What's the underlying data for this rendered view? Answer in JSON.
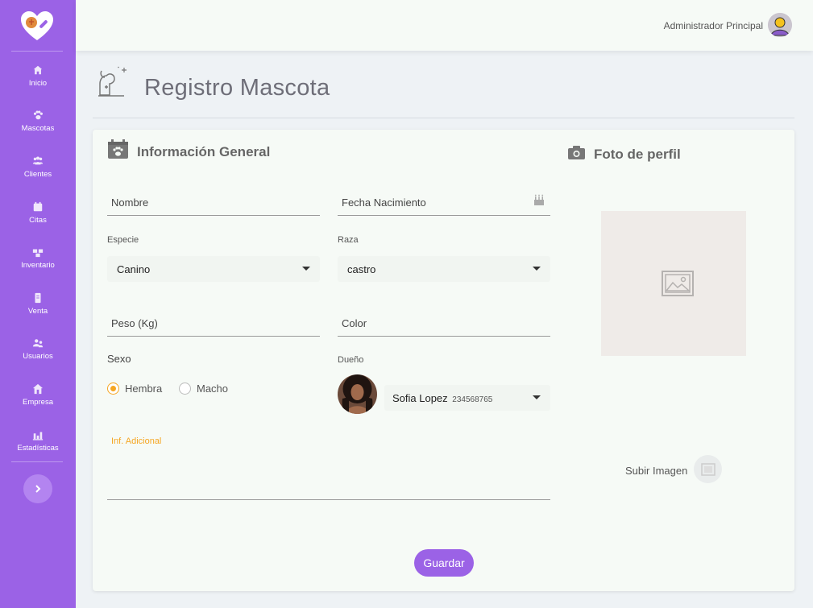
{
  "sidebar": {
    "items": [
      {
        "label": "Inicio",
        "icon": "home-icon"
      },
      {
        "label": "Mascotas",
        "icon": "paw-icon"
      },
      {
        "label": "Clientes",
        "icon": "users-icon"
      },
      {
        "label": "Citas",
        "icon": "calendar-icon"
      },
      {
        "label": "Inventario",
        "icon": "boxes-icon"
      },
      {
        "label": "Venta",
        "icon": "receipt-icon"
      },
      {
        "label": "Usuarios",
        "icon": "user-group-icon"
      },
      {
        "label": "Empresa",
        "icon": "building-icon"
      },
      {
        "label": "Estadísticas",
        "icon": "chart-icon"
      }
    ]
  },
  "header": {
    "user_name": "Administrador Principal"
  },
  "page": {
    "title": "Registro Mascota"
  },
  "general": {
    "title": "Información General",
    "nombre_label": "Nombre",
    "fecha_label": "Fecha Nacimiento",
    "especie_label": "Especie",
    "especie_value": "Canino",
    "raza_label": "Raza",
    "raza_value": "castro",
    "peso_label": "Peso (Kg)",
    "color_label": "Color",
    "sexo_label": "Sexo",
    "sexo_options": [
      "Hembra",
      "Macho"
    ],
    "sexo_selected": "Hembra",
    "dueno_label": "Dueño",
    "dueno_name": "Sofia Lopez",
    "dueno_id": "234568765",
    "info_label": "Inf. Adicional",
    "save_label": "Guardar"
  },
  "photo": {
    "title": "Foto de perfil",
    "upload_label": "Subir Imagen"
  },
  "colors": {
    "accent": "#9b62e6",
    "radio": "#f5a623",
    "info_label": "#f5a623"
  }
}
